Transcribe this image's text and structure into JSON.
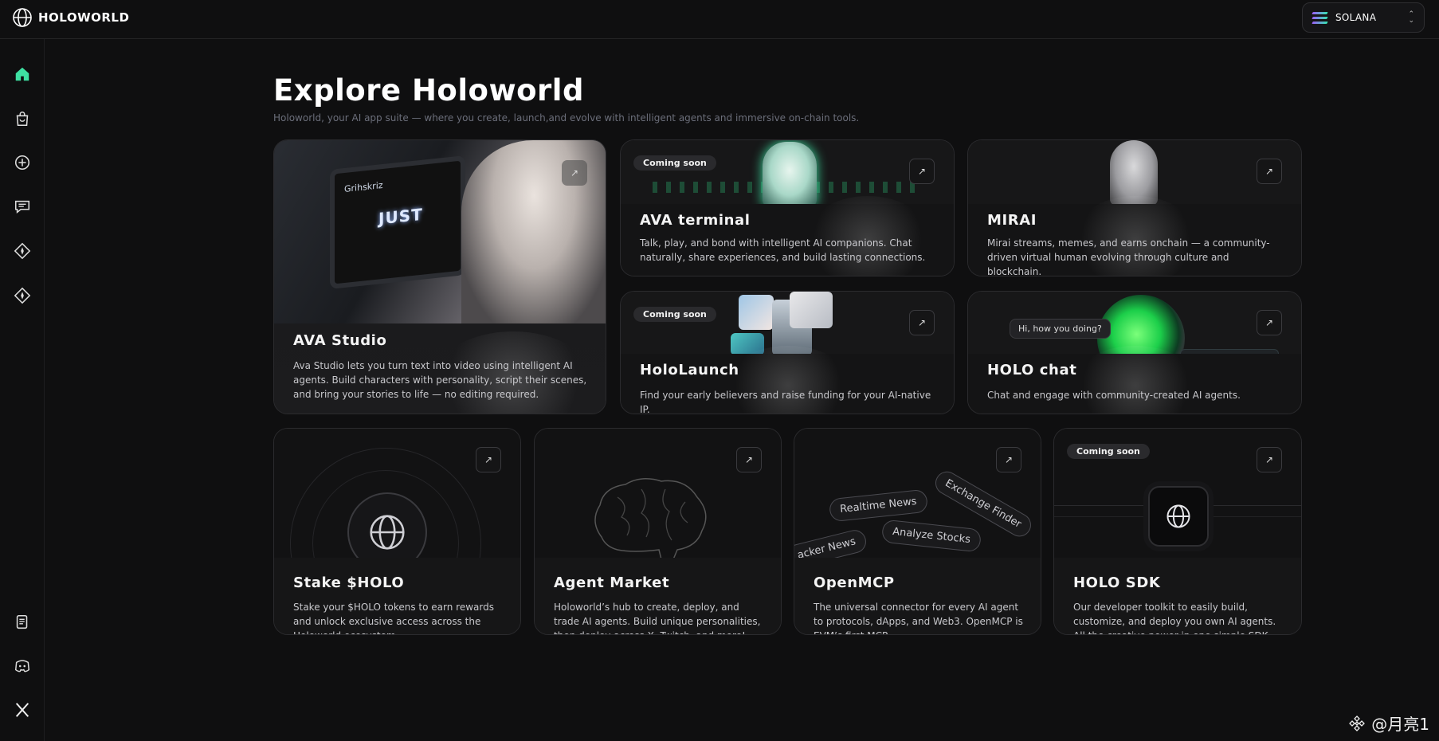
{
  "app": {
    "logo_text": "HOLOWORLD",
    "chain_selector": "SOLANA"
  },
  "sidebar": {
    "items": [
      {
        "icon": "home-icon",
        "active": true
      },
      {
        "icon": "shopping-bag-icon"
      },
      {
        "icon": "plus-circle-icon"
      },
      {
        "icon": "chat-icon"
      },
      {
        "icon": "diamond-icon"
      },
      {
        "icon": "diamond-icon"
      }
    ],
    "bottom_items": [
      {
        "icon": "document-icon"
      },
      {
        "icon": "discord-icon"
      },
      {
        "icon": "x-logo-icon"
      }
    ]
  },
  "page": {
    "title": "Explore Holoworld",
    "subtitle": "Holoworld, your AI app suite — where you create, launch,and evolve with intelligent agents and immersive on-chain tools."
  },
  "cards": {
    "ava_studio": {
      "title": "AVA Studio",
      "description": "Ava Studio lets you turn text into video using intelligent AI agents. Build characters with personality, script their scenes, and bring your stories to life — no editing required.",
      "tv_text": "JUST",
      "tv_brand": "Grihskriz"
    },
    "ava_terminal": {
      "badge": "Coming soon",
      "title": "AVA terminal",
      "description": "Talk, play, and bond with intelligent AI companions. Chat naturally, share experiences, and build lasting connections."
    },
    "mirai": {
      "title": "MIRAI",
      "description": "Mirai streams, memes, and earns onchain — a community-driven virtual human evolving through culture and blockchain."
    },
    "hololaunch": {
      "badge": "Coming soon",
      "title": "HoloLaunch",
      "description": "Find your early believers and raise funding for your AI-native IP."
    },
    "holo_chat": {
      "title": "HOLO chat",
      "description": "Chat and engage with community-created AI agents.",
      "bubble": "Hi, how you doing?"
    },
    "stake_holo": {
      "title": "Stake $HOLO",
      "description": "Stake your $HOLO tokens to earn rewards and unlock exclusive access across the Holoworld ecosystem."
    },
    "agent_market": {
      "title": "Agent Market",
      "description": "Holoworld’s hub to create, deploy, and trade AI agents. Build unique personalities, then deploy across X, Twitch, and more!"
    },
    "openmcp": {
      "title": "OpenMCP",
      "description": "The universal connector for every AI agent to protocols, dApps, and Web3. OpenMCP is EVM’s first MCP.",
      "pills": [
        "Realtime News",
        "Exchange Finder",
        "acker News",
        "Analyze Stocks"
      ]
    },
    "holo_sdk": {
      "badge": "Coming soon",
      "title": "HOLO SDK",
      "description": "Our developer toolkit to easily build, customize, and deploy you own AI agents. All the creative power in one simple SDK."
    }
  },
  "watermark": "@月亮1",
  "colors": {
    "accent": "#3ee0a2",
    "background": "#0f0f10",
    "card": "#121213"
  }
}
